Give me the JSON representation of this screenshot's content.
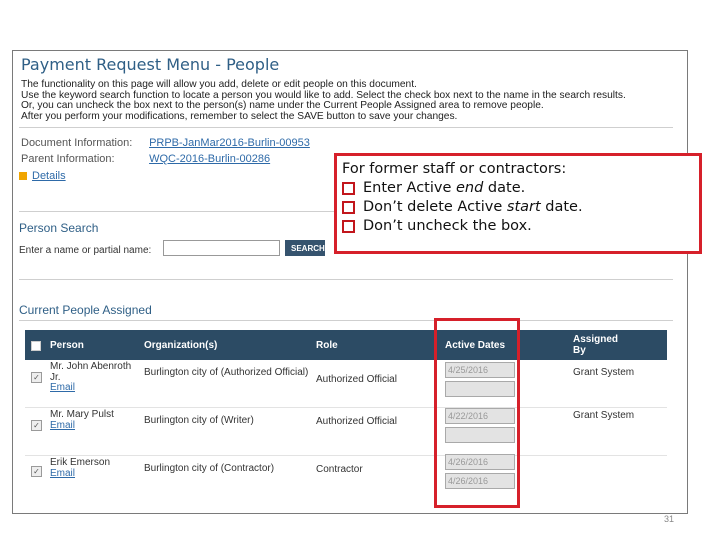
{
  "page": {
    "title": "Payment Request Menu - People",
    "intro": [
      "The functionality on this page will allow you add, delete or edit people on this document.",
      "Use the keyword search function to locate a person you would like to add. Select the check box next to the name in the search results.",
      "Or, you can uncheck the box next to the person(s) name under the Current People Assigned area to remove people.",
      "After you perform your modifications, remember to select the SAVE button to save your changes."
    ],
    "document_info_label": "Document Information:",
    "document_info_value": "PRPB-JanMar2016-Burlin-00953",
    "parent_info_label": "Parent Information:",
    "parent_info_value": "WQC-2016-Burlin-00286",
    "details_link": "Details"
  },
  "person_search": {
    "title": "Person Search",
    "label": "Enter a name or partial name:",
    "input_value": "",
    "button": "SEARCH"
  },
  "callout": {
    "heading": "For former staff or contractors:",
    "items": [
      {
        "pre": "Enter Active ",
        "em": "end",
        "post": " date."
      },
      {
        "pre": "Don’t delete Active ",
        "em": "start",
        "post": " date."
      },
      {
        "pre": "Don’t uncheck the box.",
        "em": "",
        "post": ""
      }
    ]
  },
  "current_people": {
    "title": "Current People Assigned",
    "columns": {
      "person": "Person",
      "org": "Organization(s)",
      "role": "Role",
      "dates": "Active Dates",
      "assigned_by": "Assigned By"
    },
    "rows": [
      {
        "name": "Mr. John Abenroth Jr.",
        "email": "Email",
        "org": "Burlington city of (Authorized Official)",
        "role": "Authorized Official",
        "start": "4/25/2016",
        "end": "",
        "assigned_by": "Grant System"
      },
      {
        "name": "Mr. Mary Pulst",
        "email": "Email",
        "org": "Burlington city of (Writer)",
        "role": "Authorized Official",
        "start": "4/22/2016",
        "end": "",
        "assigned_by": "Grant System"
      },
      {
        "name": "Erik Emerson",
        "email": "Email",
        "org": "Burlington city of (Contractor)",
        "role": "Contractor",
        "start": "4/26/2016",
        "end": "4/26/2016",
        "assigned_by": ""
      }
    ]
  },
  "slide_number": "31",
  "colors": {
    "accent": "#2f5f86",
    "header_bg": "#2c4b64",
    "highlight": "#d6202a",
    "link": "#2e6aa8"
  }
}
